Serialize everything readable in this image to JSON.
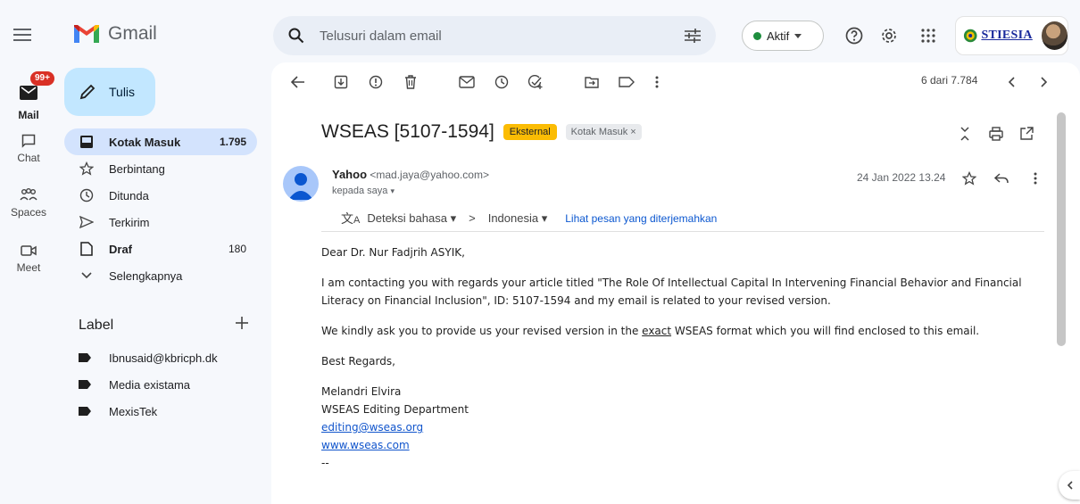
{
  "app": {
    "name": "Gmail"
  },
  "search": {
    "placeholder": "Telusuri dalam email"
  },
  "status": {
    "label": "Aktif",
    "color": "#1e8e3e"
  },
  "brand": {
    "text": "STIESIA"
  },
  "rail": {
    "mail": {
      "label": "Mail",
      "badge": "99+"
    },
    "chat": {
      "label": "Chat"
    },
    "spaces": {
      "label": "Spaces"
    },
    "meet": {
      "label": "Meet"
    }
  },
  "compose": {
    "label": "Tulis"
  },
  "nav": [
    {
      "label": "Kotak Masuk",
      "count": "1.795",
      "icon": "inbox-icon"
    },
    {
      "label": "Berbintang",
      "count": "",
      "icon": "star-icon"
    },
    {
      "label": "Ditunda",
      "count": "",
      "icon": "clock-icon"
    },
    {
      "label": "Terkirim",
      "count": "",
      "icon": "send-icon"
    },
    {
      "label": "Draf",
      "count": "180",
      "icon": "draft-icon"
    },
    {
      "label": "Selengkapnya",
      "count": "",
      "icon": "chevron-down-icon"
    }
  ],
  "labels": {
    "title": "Label",
    "items": [
      "Ibnusaid@kbricph.dk",
      "Media existama",
      "MexisTek"
    ]
  },
  "pager": {
    "text": "6 dari 7.784"
  },
  "email": {
    "subject": "WSEAS [5107-1594]",
    "chip_external": "Eksternal",
    "chip_inbox": "Kotak Masuk ×",
    "sender_name": "Yahoo",
    "sender_email": "<mad.jaya@yahoo.com>",
    "to": "kepada saya",
    "date": "24 Jan 2022 13.24",
    "translate": {
      "detect": "Deteksi bahasa",
      "target": "Indonesia",
      "link": "Lihat pesan yang diterjemahkan"
    },
    "greeting": "Dear Dr. Nur Fadjrih ASYIK,",
    "para1": "I am contacting you with regards your article titled \"The Role Of Intellectual Capital In Intervening Financial Behavior and Financial Literacy on Financial Inclusion\", ID: 5107-1594 and my email is related to your revised version.",
    "para2_pre": "We kindly ask you to provide us your revised version in the ",
    "para2_em": "exact",
    "para2_post": " WSEAS format which you will find enclosed to this email.",
    "closing": "Best Regards,",
    "sig_name": "Melandri Elvira",
    "sig_dept": "WSEAS Editing Department",
    "sig_email": "editing@wseas.org",
    "sig_web": "www.wseas.com",
    "sig_sep": "--"
  }
}
